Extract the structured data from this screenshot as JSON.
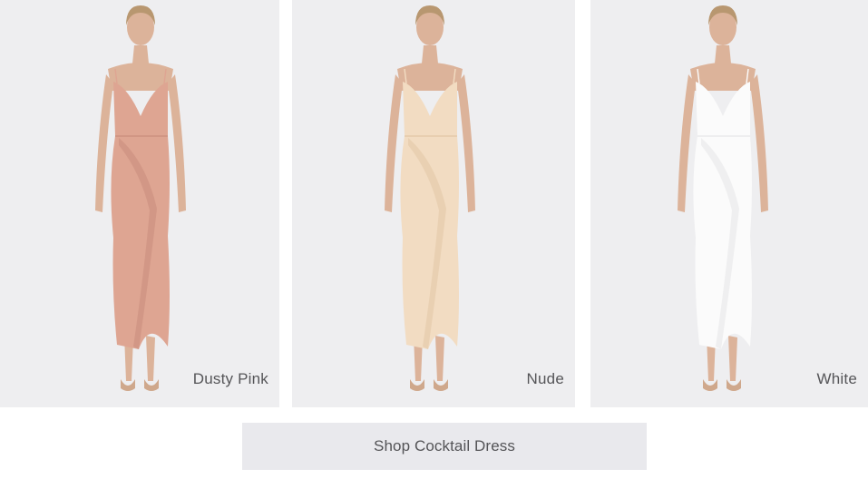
{
  "products": [
    {
      "label": "Dusty Pink",
      "dress_color": "#dea592",
      "shade_color": "#c98d7b"
    },
    {
      "label": "Nude",
      "dress_color": "#f2dcc2",
      "shade_color": "#e2c6a6"
    },
    {
      "label": "White",
      "dress_color": "#fbfbfb",
      "shade_color": "#e6e6e8"
    }
  ],
  "cta": {
    "label": "Shop Cocktail Dress"
  },
  "colors": {
    "card_bg": "#eeeef0",
    "button_bg": "#e9e9ed",
    "text": "#555558",
    "skin": "#dcb39a",
    "hair": "#b89770"
  }
}
